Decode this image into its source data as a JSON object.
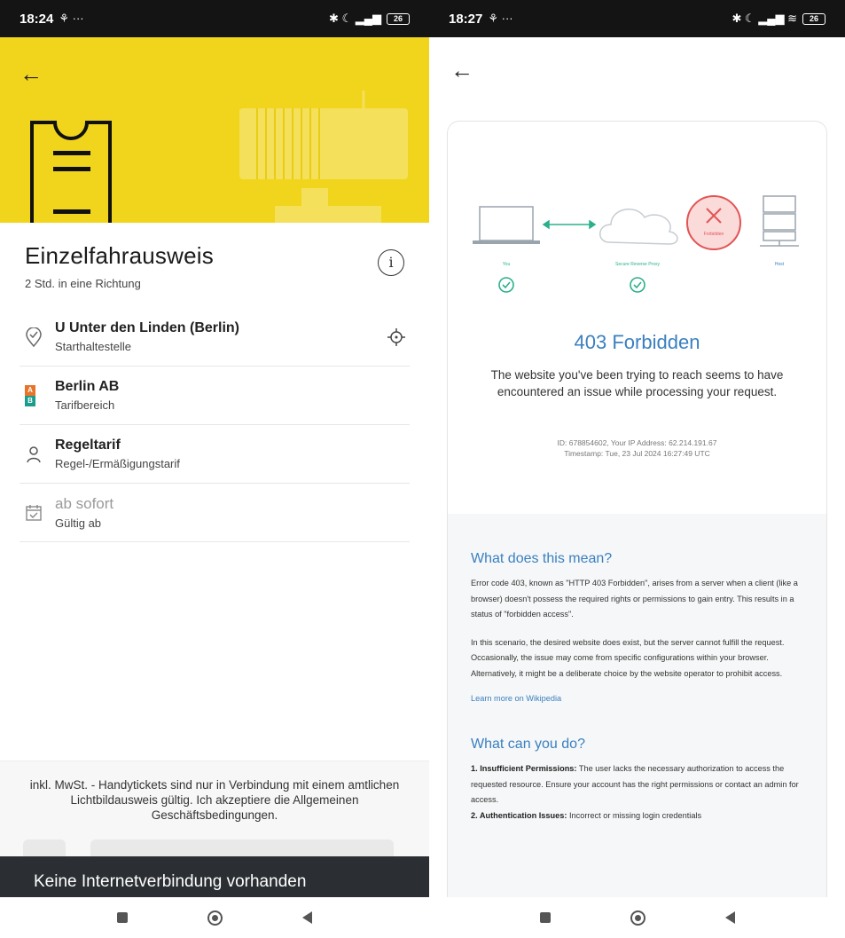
{
  "left": {
    "status": {
      "time": "18:24",
      "indicators": "⚘ ···",
      "icons": "✱ ☾ ▂▄▆",
      "battery": "26"
    },
    "ticket": {
      "title": "Einzelfahrausweis",
      "subtitle": "2 Std. in eine Richtung"
    },
    "options": [
      {
        "label": "U Unter den Linden (Berlin)",
        "sublabel": "Starthaltestelle",
        "icon": "location-check-icon"
      },
      {
        "label": "Berlin AB",
        "sublabel": "Tarifbereich",
        "icon": "zone-ab-icon"
      },
      {
        "label": "Regeltarif",
        "sublabel": "Regel-/Ermäßigungstarif",
        "icon": "person-icon"
      },
      {
        "label": "ab sofort",
        "sublabel": "Gültig ab",
        "icon": "calendar-check-icon"
      }
    ],
    "zone_badge": {
      "a": "A",
      "b": "B",
      "color_a": "#e8742a",
      "color_b": "#1c9c8c"
    },
    "footer_text": "inkl. MwSt. - Handytickets sind nur in Verbindung mit einem amtlichen Lichtbildausweis gültig. Ich akzeptiere die Allgemeinen Geschäftsbedingungen.",
    "snackbar": "Keine Internetverbindung vorhanden",
    "brand_color": "#f1d51c"
  },
  "right": {
    "status": {
      "time": "18:27",
      "indicators": "⚘ ···",
      "icons": "✱ ☾ ▂▄▆ ≋",
      "battery": "26"
    },
    "diagram": {
      "you": "You",
      "proxy": "Secure Reverse Proxy",
      "host": "Host",
      "forbidden": "Forbidden"
    },
    "error": {
      "title": "403 Forbidden",
      "description": "The website you've been trying to reach seems to have encountered an issue while processing your request.",
      "id_line": "ID: 678854602, Your IP Address: 62.214.191.67",
      "timestamp_line": "Timestamp: Tue, 23 Jul 2024 16:27:49 UTC"
    },
    "meaning": {
      "title": "What does this mean?",
      "p1": "Error code 403, known as \"HTTP 403 Forbidden\", arises from a server when a client (like a browser) doesn't possess the required rights or permissions to gain entry. This results in a status of \"forbidden access\".",
      "p2": "In this scenario, the desired website does exist, but the server cannot fulfill the request. Occasionally, the issue may come from specific configurations within your browser. Alternatively, it might be a deliberate choice by the website operator to prohibit access.",
      "link": "Learn more on Wikipedia"
    },
    "todo": {
      "title": "What can you do?",
      "item1_label": "1. Insufficient Permissions:",
      "item1_text": " The user lacks the necessary authorization to access the requested resource. Ensure your account has the right permissions or contact an admin for access.",
      "item2_label": "2. Authentication Issues:",
      "item2_text": " Incorrect or missing login credentials"
    },
    "accent_color": "#3a80c0",
    "error_color": "#e25555"
  }
}
